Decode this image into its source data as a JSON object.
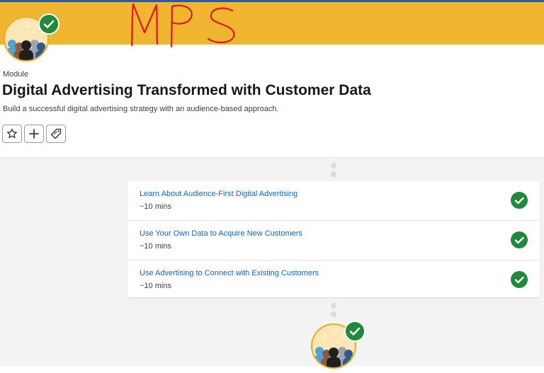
{
  "annotation_text": "MPS",
  "module": {
    "kicker": "Module",
    "title": "Digital Advertising Transformed with Customer Data",
    "subtitle": "Build a successful digital advertising strategy with an audience-based approach."
  },
  "actions": [
    {
      "icon": "star-outline-icon"
    },
    {
      "icon": "plus-icon"
    },
    {
      "icon": "tag-icon"
    }
  ],
  "units": [
    {
      "title": "Learn About Audience-First Digital Advertising",
      "time": "~10 mins",
      "completed": true
    },
    {
      "title": "Use Your Own Data to Acquire New Customers",
      "time": "~10 mins",
      "completed": true
    },
    {
      "title": "Use Advertising to Connect with Existing Customers",
      "time": "~10 mins",
      "completed": true
    }
  ],
  "colors": {
    "banner": "#f0b62f",
    "link": "#0b65c2",
    "success": "#1f8a3b",
    "annotation": "#e8121f"
  }
}
